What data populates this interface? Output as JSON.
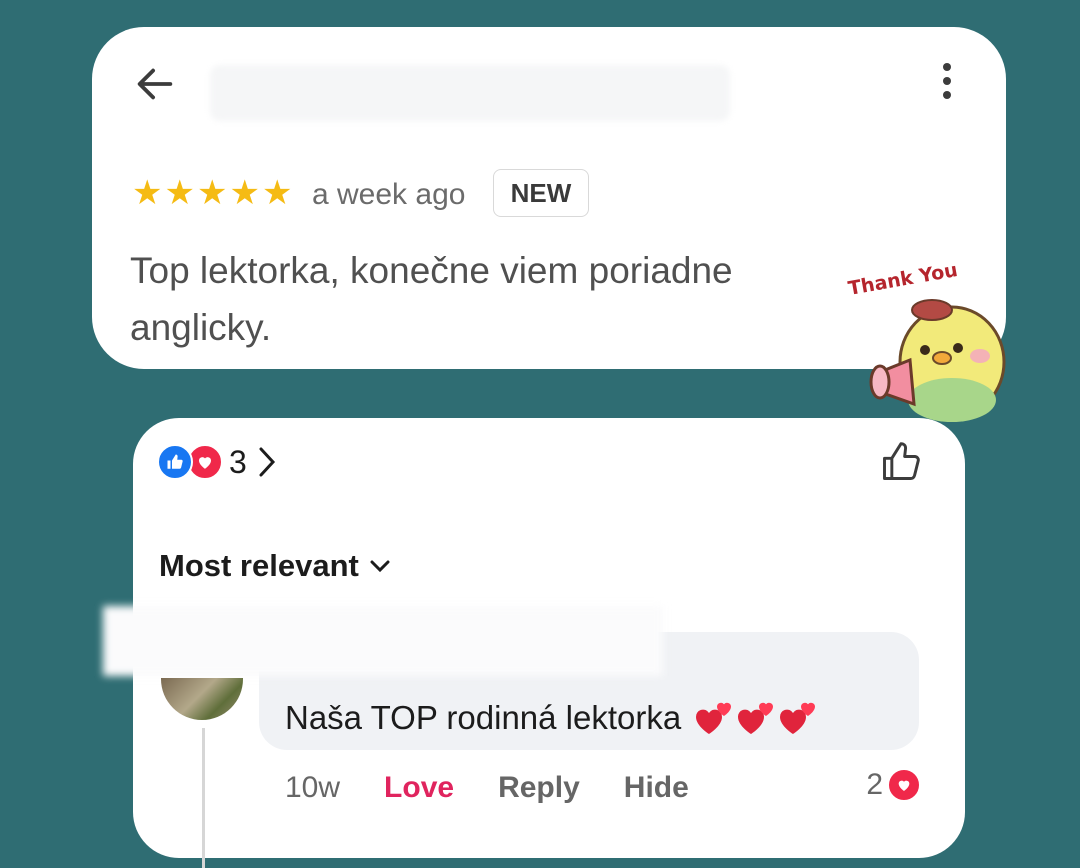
{
  "review": {
    "rating_stars": 5,
    "stars": [
      "★",
      "★",
      "★",
      "★",
      "★"
    ],
    "time": "a week ago",
    "badge": "NEW",
    "text": "Top lektorka, konečne viem poriadne anglicky.",
    "sticker_text": "Thank You",
    "icons": {
      "back": "arrow-left-icon",
      "menu": "more-vertical-icon"
    }
  },
  "reactions": {
    "count": "3",
    "types": [
      "like",
      "love"
    ]
  },
  "sort": {
    "label": "Most relevant"
  },
  "comment": {
    "text": "Naša TOP rodinná lektorka",
    "time": "10w",
    "love_label": "Love",
    "reply_label": "Reply",
    "hide_label": "Hide",
    "love_count": "2"
  },
  "colors": {
    "background": "#2f6d73",
    "star": "#f5bb14",
    "love": "#e0245e",
    "like": "#1877f2"
  }
}
